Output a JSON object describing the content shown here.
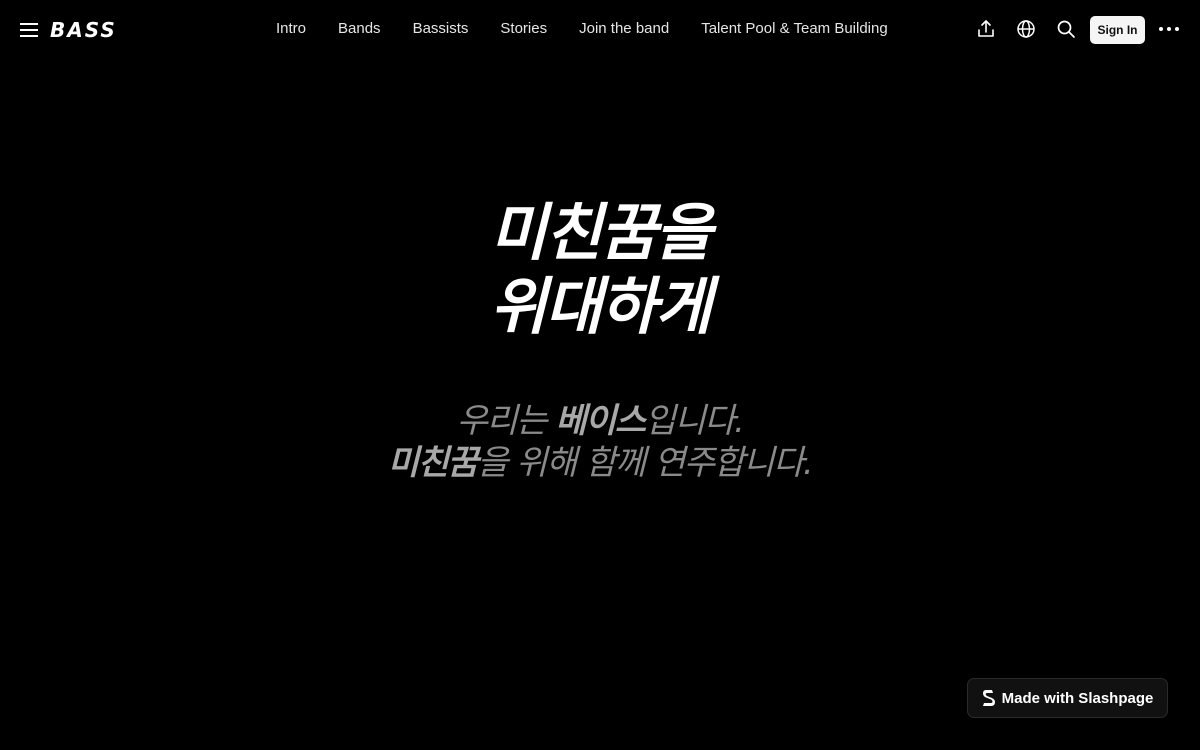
{
  "header": {
    "logo_text": "BASS",
    "nav": [
      {
        "label": "Intro"
      },
      {
        "label": "Bands"
      },
      {
        "label": "Bassists"
      },
      {
        "label": "Stories"
      },
      {
        "label": "Join the band"
      },
      {
        "label": "Talent Pool & Team Building"
      }
    ],
    "sign_in_label": "Sign In",
    "icons": [
      "menu-icon",
      "share-icon",
      "globe-icon",
      "search-icon",
      "more-icon"
    ]
  },
  "hero": {
    "title_line1": "미친꿈을",
    "title_line2": "위대하게",
    "sub_line1_a": "우리는 ",
    "sub_line1_b": "베이스",
    "sub_line1_c": "입니다.",
    "sub_line2_a": "미친꿈",
    "sub_line2_b": "을 위해 함께 연주합니다."
  },
  "badge": {
    "label": "Made with Slashpage",
    "icon": "slashpage-logo-icon"
  },
  "colors": {
    "background": "#000000",
    "text": "#ffffff",
    "subtext": "#8a8a8a",
    "button_bg": "#f5f5f5"
  }
}
